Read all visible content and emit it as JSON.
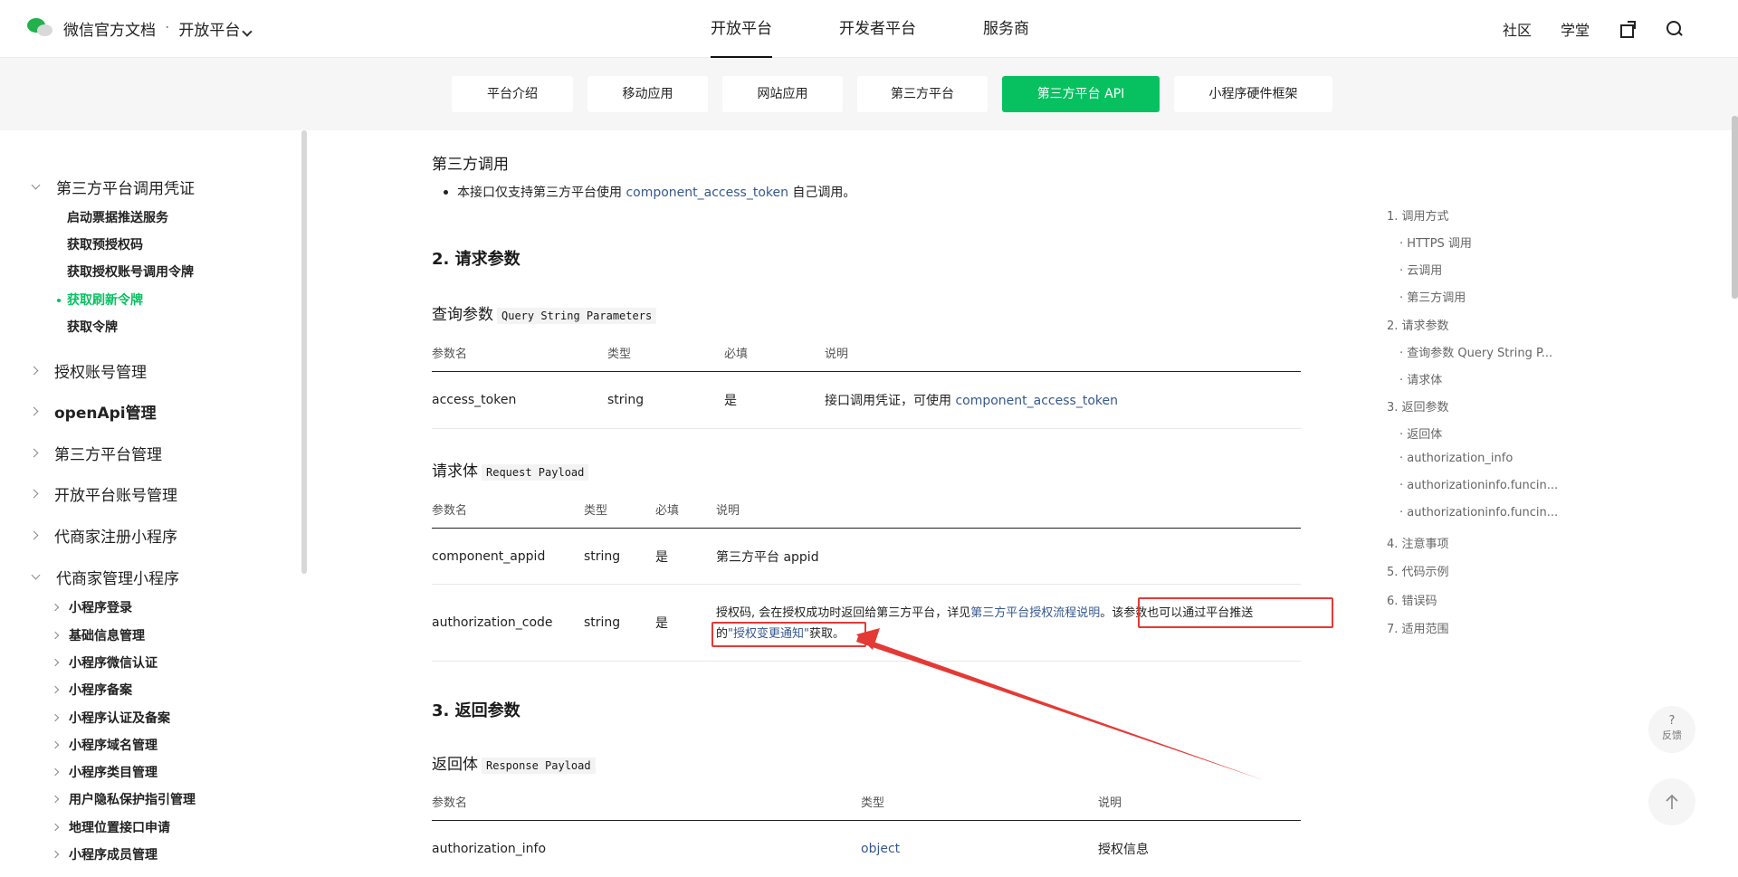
{
  "header": {
    "brand": "微信官方文档",
    "separator": "·",
    "platform": "开放平台",
    "nav": [
      "开放平台",
      "开发者平台",
      "服务商"
    ],
    "tools": [
      "社区",
      "学堂"
    ]
  },
  "tabs": [
    "平台介绍",
    "移动应用",
    "网站应用",
    "第三方平台",
    "第三方平台 API",
    "小程序硬件框架"
  ],
  "sidebar": {
    "group_credentials": "第三方平台调用凭证",
    "credential_items": [
      "启动票据推送服务",
      "获取预授权码",
      "获取授权账号调用令牌",
      "获取刷新令牌",
      "获取令牌"
    ],
    "groups": [
      "授权账号管理",
      "openApi管理",
      "第三方平台管理",
      "开放平台账号管理",
      "代商家注册小程序"
    ],
    "group_manage": "代商家管理小程序",
    "manage_items": [
      "小程序登录",
      "基础信息管理",
      "小程序微信认证",
      "小程序备案",
      "小程序认证及备案",
      "小程序域名管理",
      "小程序类目管理",
      "用户隐私保护指引管理",
      "地理位置接口申请",
      "小程序成员管理"
    ]
  },
  "content": {
    "third_call_title": "第三方调用",
    "third_call_text_pre": "本接口仅支持第三方平台使用 ",
    "third_call_link": "component_access_token",
    "third_call_text_post": " 自己调用。",
    "section2": "2. 请求参数",
    "query_title": "查询参数",
    "query_code": "Query String Parameters",
    "headers4": [
      "参数名",
      "类型",
      "必填",
      "说明"
    ],
    "query_row": {
      "name": "access_token",
      "type": "string",
      "req": "是",
      "desc_pre": "接口调用凭证，可使用 ",
      "desc_link": "component_access_token"
    },
    "payload_title": "请求体",
    "payload_code": "Request Payload",
    "payload_row1": {
      "name": "component_appid",
      "type": "string",
      "req": "是",
      "desc": "第三方平台 appid"
    },
    "payload_row2": {
      "name": "authorization_code",
      "type": "string",
      "req": "是",
      "desc_pre": "授权码, 会在授权成功时返回给第三方平台，详见",
      "desc_link1": "第三方平台授权流程说明",
      "desc_mid": "。该参数也可以通过平台推送",
      "desc_line2_pre": "的",
      "desc_link2": "\"授权变更通知\"",
      "desc_post": "获取。"
    },
    "section3": "3. 返回参数",
    "resp_title": "返回体",
    "resp_code": "Response Payload",
    "headers3": [
      "参数名",
      "类型",
      "说明"
    ],
    "resp_row": {
      "name": "authorization_info",
      "type": "object",
      "desc": "授权信息"
    }
  },
  "toc": [
    "1. 调用方式",
    "· HTTPS 调用",
    "· 云调用",
    "· 第三方调用",
    "2. 请求参数",
    "· 查询参数 Query String P...",
    "· 请求体",
    "3. 返回参数",
    "· 返回体",
    "· authorization_info",
    "· authorizationinfo.funcin...",
    "· authorizationinfo.funcin...",
    "4. 注意事项",
    "5. 代码示例",
    "6. 错误码",
    "7. 适用范围"
  ],
  "float": {
    "help_symbol": "?",
    "help_label": "反馈"
  },
  "colors": {
    "accent": "#07c160",
    "link": "#36588f",
    "annotation": "#e53935"
  }
}
